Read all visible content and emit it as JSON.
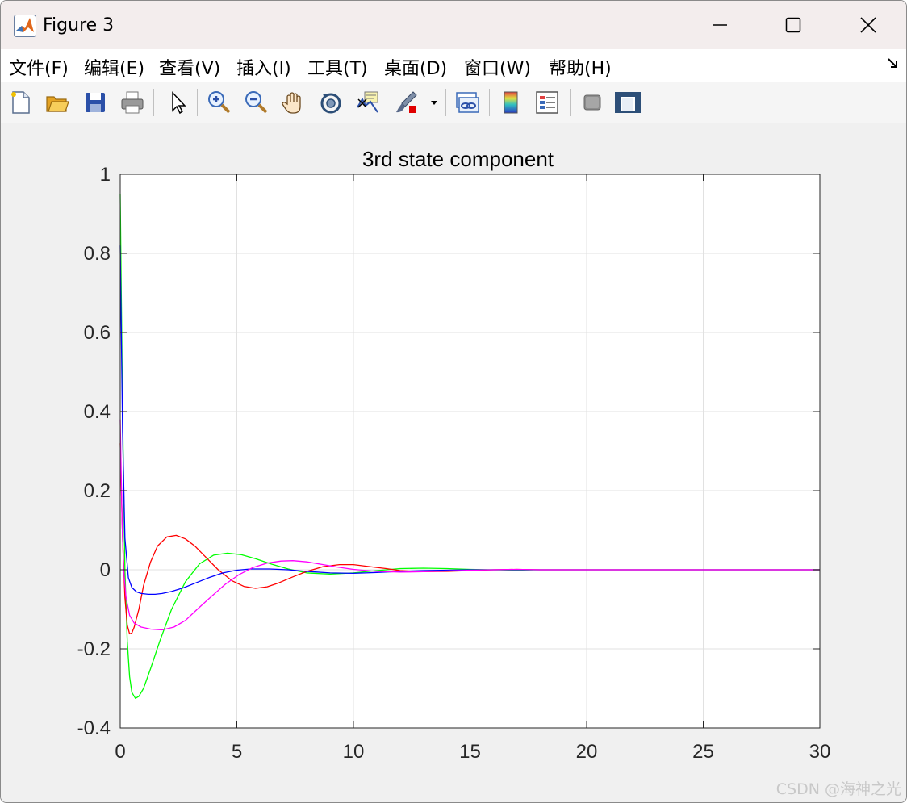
{
  "window": {
    "title": "Figure 3",
    "minimize_icon": "minimize-icon",
    "maximize_icon": "maximize-icon",
    "close_icon": "close-icon"
  },
  "menubar": {
    "items": [
      "文件(F)",
      "编辑(E)",
      "查看(V)",
      "插入(I)",
      "工具(T)",
      "桌面(D)",
      "窗口(W)",
      "帮助(H)"
    ]
  },
  "toolbar": {
    "buttons": [
      "new-figure-icon",
      "open-icon",
      "save-icon",
      "print-icon",
      "pointer-icon",
      "zoom-in-icon",
      "zoom-out-icon",
      "pan-hand-icon",
      "rotate-3d-icon",
      "data-cursor-icon",
      "brush-icon",
      "dropdown-arrow-icon",
      "link-plot-icon",
      "colorbar-icon",
      "legend-icon",
      "hide-plot-tools-icon",
      "show-plot-tools-icon"
    ]
  },
  "watermark": "CSDN @海神之光",
  "chart_data": {
    "type": "line",
    "title": "3rd state component",
    "xlabel": "",
    "ylabel": "",
    "xlim": [
      0,
      30
    ],
    "ylim": [
      -0.4,
      1
    ],
    "xticks": [
      "0",
      "5",
      "10",
      "15",
      "20",
      "25",
      "30"
    ],
    "yticks": [
      "-0.4",
      "-0.2",
      "0",
      "0.2",
      "0.4",
      "0.6",
      "0.8",
      "1"
    ],
    "grid": true,
    "series": [
      {
        "color": "#00ff00",
        "x": [
          0,
          0.1,
          0.2,
          0.3,
          0.4,
          0.5,
          0.65,
          0.8,
          1.0,
          1.3,
          1.7,
          2.2,
          2.8,
          3.4,
          4.0,
          4.6,
          5.2,
          5.8,
          6.5,
          7.2,
          8.0,
          9.0,
          10.0,
          11.0,
          12.0,
          13.0,
          14.0,
          15.0,
          16.0,
          17.0,
          18.0,
          20.0,
          25.0,
          30.0
        ],
        "y": [
          0.95,
          0.4,
          0.0,
          -0.18,
          -0.27,
          -0.31,
          -0.325,
          -0.32,
          -0.3,
          -0.25,
          -0.18,
          -0.1,
          -0.03,
          0.015,
          0.037,
          0.042,
          0.038,
          0.028,
          0.014,
          0.002,
          -0.008,
          -0.011,
          -0.008,
          -0.002,
          0.003,
          0.004,
          0.003,
          0.001,
          0.0,
          -0.001,
          0.0,
          0.0,
          0.0,
          0.0
        ]
      },
      {
        "color": "#ff0000",
        "x": [
          0,
          0.1,
          0.2,
          0.3,
          0.4,
          0.5,
          0.6,
          0.8,
          1.0,
          1.3,
          1.6,
          2.0,
          2.4,
          2.8,
          3.2,
          3.7,
          4.2,
          4.8,
          5.3,
          5.8,
          6.3,
          6.8,
          7.4,
          8.0,
          8.7,
          9.4,
          10.0,
          10.7,
          11.4,
          12.0,
          13.0,
          14.0,
          15.0,
          16.0,
          17.0,
          18.0,
          20.0,
          25.0,
          30.0
        ],
        "y": [
          0.32,
          0.08,
          -0.07,
          -0.14,
          -0.162,
          -0.16,
          -0.145,
          -0.1,
          -0.04,
          0.02,
          0.06,
          0.083,
          0.087,
          0.078,
          0.06,
          0.03,
          0.0,
          -0.028,
          -0.042,
          -0.047,
          -0.043,
          -0.033,
          -0.018,
          -0.004,
          0.008,
          0.013,
          0.013,
          0.008,
          0.003,
          -0.002,
          -0.005,
          -0.004,
          -0.002,
          0.0,
          0.001,
          0.0,
          0.0,
          0.0,
          0.0
        ]
      },
      {
        "color": "#0000ff",
        "x": [
          0,
          0.1,
          0.2,
          0.35,
          0.5,
          0.7,
          0.9,
          1.2,
          1.5,
          1.8,
          2.2,
          2.7,
          3.2,
          3.8,
          4.4,
          5.0,
          5.6,
          6.4,
          7.2,
          8.0,
          9.0,
          10.0,
          11.0,
          12.0,
          13.0,
          15.0,
          17.0,
          20.0,
          25.0,
          30.0
        ],
        "y": [
          0.82,
          0.35,
          0.08,
          -0.02,
          -0.045,
          -0.056,
          -0.06,
          -0.062,
          -0.062,
          -0.06,
          -0.055,
          -0.046,
          -0.034,
          -0.02,
          -0.008,
          -0.001,
          0.002,
          0.002,
          0.0,
          -0.004,
          -0.008,
          -0.009,
          -0.007,
          -0.004,
          -0.002,
          0.0,
          0.0,
          0.0,
          0.0,
          0.0
        ]
      },
      {
        "color": "#ff00ff",
        "x": [
          0,
          0.08,
          0.15,
          0.25,
          0.4,
          0.6,
          0.9,
          1.3,
          1.8,
          2.3,
          2.8,
          3.3,
          3.9,
          4.5,
          5.1,
          5.7,
          6.3,
          6.9,
          7.4,
          8.0,
          8.6,
          9.3,
          10.0,
          11.0,
          12.0,
          13.0,
          14.0,
          15.0,
          16.0,
          17.0,
          18.0,
          20.0,
          25.0,
          30.0
        ],
        "y": [
          0.38,
          0.12,
          0.0,
          -0.07,
          -0.115,
          -0.135,
          -0.145,
          -0.15,
          -0.152,
          -0.145,
          -0.128,
          -0.1,
          -0.068,
          -0.037,
          -0.012,
          0.006,
          0.017,
          0.022,
          0.023,
          0.02,
          0.014,
          0.007,
          0.001,
          -0.004,
          -0.006,
          -0.005,
          -0.003,
          -0.001,
          0.0,
          0.001,
          0.0,
          0.0,
          0.0,
          0.0
        ]
      }
    ]
  }
}
